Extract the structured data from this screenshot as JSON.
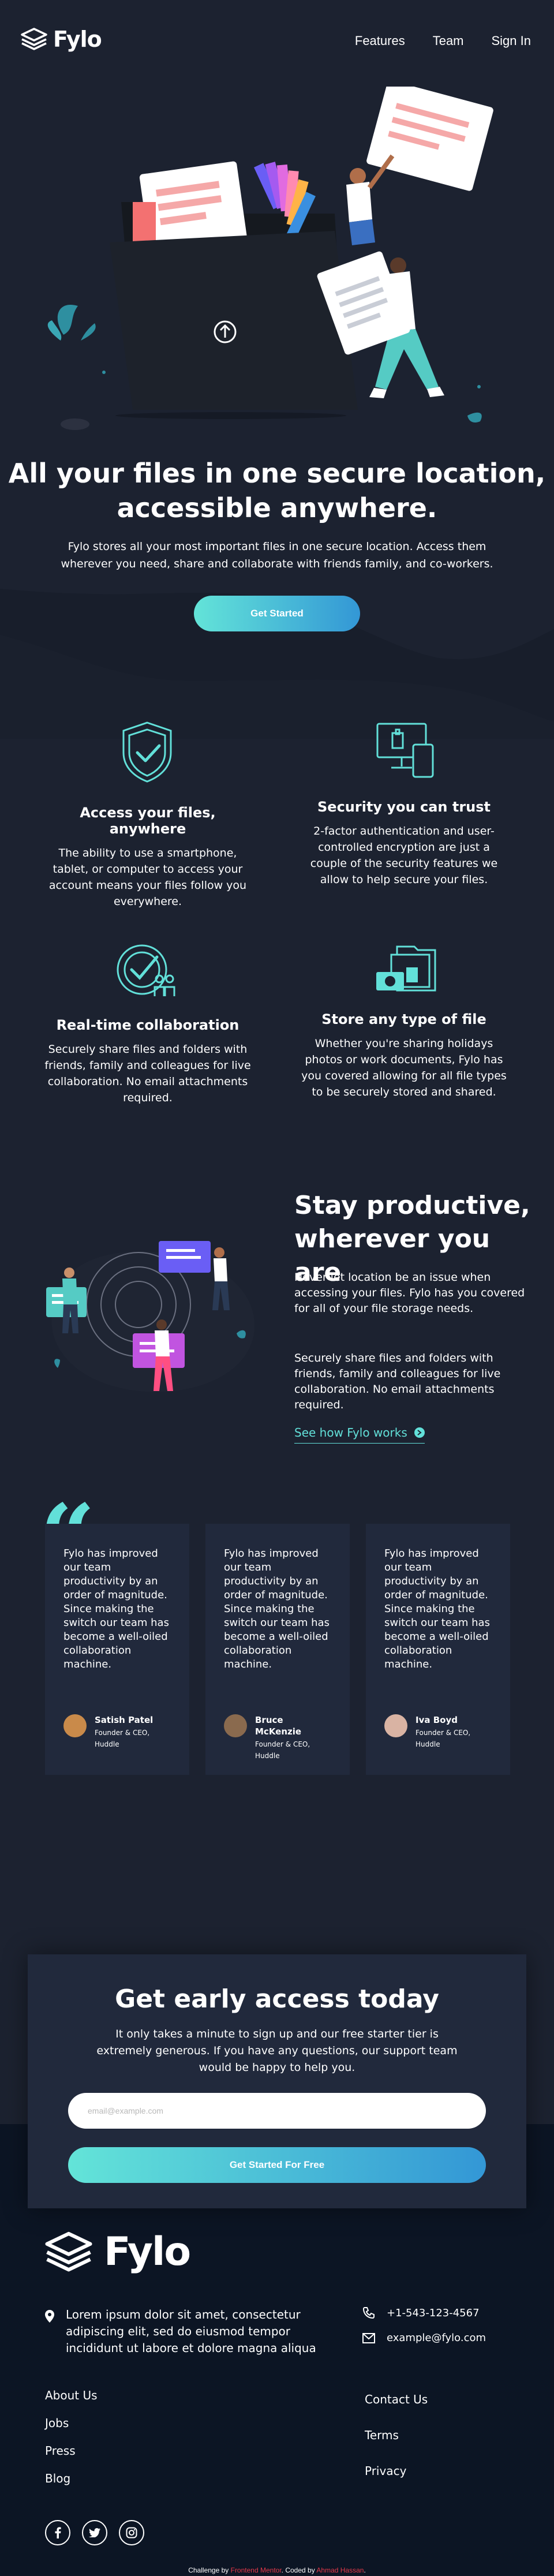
{
  "header": {
    "brand": "Fylo",
    "nav": [
      "Features",
      "Team",
      "Sign In"
    ]
  },
  "hero": {
    "title_line1": "All your files in one secure location,",
    "title_line2": "accessible anywhere.",
    "text": "Fylo stores all your most important files in one secure location. Access them wherever you need, share and collaborate with friends family, and co-workers.",
    "button": "Get Started"
  },
  "features": [
    {
      "icon": "access-shield-icon",
      "title": "Access your files, anywhere",
      "text": "The ability to use a smartphone, tablet, or computer to access your account means your files follow you everywhere."
    },
    {
      "icon": "security-devices-icon",
      "title": "Security you can trust",
      "text": "2-factor authentication and user-controlled encryption are just a couple of the security features we allow to help secure your files."
    },
    {
      "icon": "collaboration-icon",
      "title": "Real-time collaboration",
      "text": "Securely share files and folders with friends, family and colleagues for live collaboration. No email attachments required."
    },
    {
      "icon": "file-types-icon",
      "title": "Store any type of file",
      "text": "Whether you're sharing holidays photos or work documents, Fylo has you covered allowing for all file types to be securely stored and shared."
    }
  ],
  "productive": {
    "title_line1": "Stay productive,",
    "title_line2": "wherever you are",
    "p1": "Never let location be an issue when accessing your files. Fylo has you covered for all of your file storage needs.",
    "p2": "Securely share files and folders with friends, family and colleagues for live collaboration. No email attachments required.",
    "link": "See how Fylo works"
  },
  "testimonials": [
    {
      "text": "Fylo has improved our team productivity by an order of magnitude. Since making the switch our team has become a well-oiled collaboration machine.",
      "name": "Satish Patel",
      "role_line1": "Founder & CEO,",
      "role_line2": "Huddle",
      "avatar_color": "#c98a4a"
    },
    {
      "text": "Fylo has improved our team productivity by an order of magnitude. Since making the switch our team has become a well-oiled collaboration machine.",
      "name_line1": "Bruce",
      "name_line2": "McKenzie",
      "role_line1": "Founder & CEO,",
      "role_line2": "Huddle",
      "avatar_color": "#8a6a4e"
    },
    {
      "text": "Fylo has improved our team productivity by an order of magnitude. Since making the switch our team has become a well-oiled collaboration machine.",
      "name": "Iva Boyd",
      "role_line1": "Founder & CEO,",
      "role_line2": "Huddle",
      "avatar_color": "#d9b3a3"
    }
  ],
  "cta": {
    "title": "Get early access today",
    "text": "It only takes a minute to sign up and our free starter tier is extremely generous. If you have any questions, our support team would be happy to help you.",
    "placeholder": "email@example.com",
    "button": "Get Started For Free"
  },
  "footer": {
    "brand": "Fylo",
    "address": "Lorem ipsum dolor sit amet, consectetur adipiscing elit, sed do eiusmod tempor incididunt ut labore et dolore magna aliqua",
    "phone": "+1-543-123-4567",
    "email": "example@fylo.com",
    "links_col1": [
      "About Us",
      "Jobs",
      "Press",
      "Blog"
    ],
    "links_col2": [
      "Contact Us",
      "Terms",
      "Privacy"
    ],
    "socials": [
      "facebook-icon",
      "twitter-icon",
      "instagram-icon"
    ]
  },
  "attribution": {
    "prefix": "Challenge by ",
    "challenge_link": "Frontend Mentor",
    "middle": ". Coded by ",
    "author_link": "Ahmad Hassan",
    "suffix": "."
  },
  "colors": {
    "background": "#1c2230",
    "card": "#21293c",
    "footer": "#0c1524",
    "accent_cyan": "#62e0d9",
    "accent_blue": "#3397d6",
    "attribution_link": "#e5394a"
  }
}
